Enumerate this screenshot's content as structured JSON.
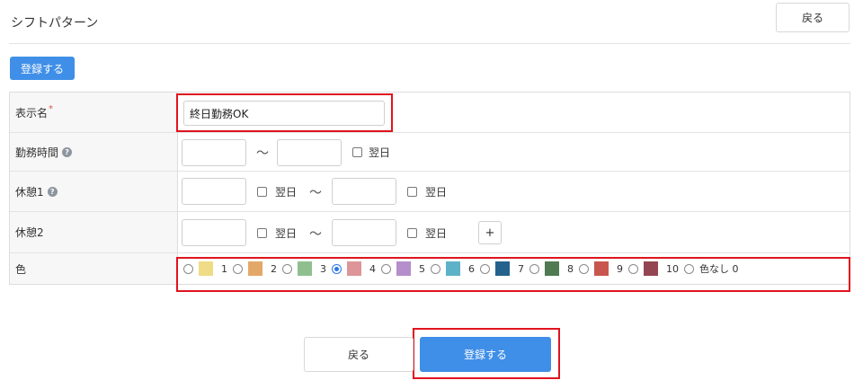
{
  "header": {
    "title": "シフトパターン",
    "back_label": "戻る"
  },
  "toolbar": {
    "register_label": "登録する"
  },
  "form": {
    "display_name": {
      "label": "表示名",
      "required_mark": "*",
      "value": "終日勤務OK"
    },
    "work_time": {
      "label": "勤務時間",
      "start": "",
      "end": "",
      "tilde": "〜",
      "next_day_label": "翌日"
    },
    "break1": {
      "label": "休憩1",
      "start": "",
      "end": "",
      "tilde": "〜",
      "next_day_label": "翌日"
    },
    "break2": {
      "label": "休憩2",
      "start": "",
      "end": "",
      "tilde": "〜",
      "next_day_label": "翌日",
      "add_label": "+"
    },
    "color": {
      "label": "色",
      "selected": "4",
      "options": [
        {
          "value": "1",
          "label": "1",
          "color": "#f0db86"
        },
        {
          "value": "2",
          "label": "2",
          "color": "#e3a868"
        },
        {
          "value": "3",
          "label": "3",
          "color": "#8fbf8f"
        },
        {
          "value": "4",
          "label": "4",
          "color": "#dd9599"
        },
        {
          "value": "5",
          "label": "5",
          "color": "#b48fcb"
        },
        {
          "value": "6",
          "label": "6",
          "color": "#5db2c8"
        },
        {
          "value": "7",
          "label": "7",
          "color": "#23628c"
        },
        {
          "value": "8",
          "label": "8",
          "color": "#4f7a52"
        },
        {
          "value": "9",
          "label": "9",
          "color": "#c8564e"
        },
        {
          "value": "10",
          "label": "10",
          "color": "#944552"
        },
        {
          "value": "0",
          "label": "色なし 0",
          "color": ""
        }
      ]
    }
  },
  "footer": {
    "back_label": "戻る",
    "register_label": "登録する"
  },
  "help_icon_glyph": "?",
  "accent_color": "#3f8fe8",
  "highlight_color": "#e0141e"
}
